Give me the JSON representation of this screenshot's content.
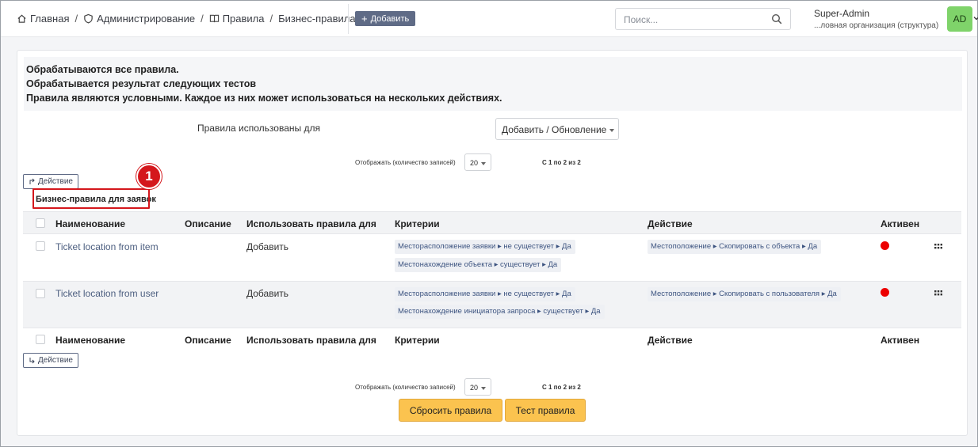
{
  "breadcrumb": [
    {
      "label": "Главная",
      "icon": "home-icon"
    },
    {
      "label": "Администрирование",
      "icon": "shield-icon"
    },
    {
      "label": "Правила",
      "icon": "book-icon"
    },
    {
      "label": "Бизнес-правила..."
    }
  ],
  "header": {
    "add_label": "Добавить",
    "search_placeholder": "Поиск...",
    "user_name": "Super-Admin",
    "user_org": "...ловная организация (структура)",
    "avatar": "AD"
  },
  "info": {
    "line1": "Обрабатываются все правила.",
    "line2": "Обрабатывается результат следующих тестов",
    "line3": "Правила являются условными. Каждое из них может использоваться на нескольких действиях."
  },
  "filter": {
    "label": "Правила использованы для",
    "selected": "Добавить / Обновление"
  },
  "pager": {
    "label": "Отображать (количество записей)",
    "value": "20",
    "count": "С 1 по 2 из 2"
  },
  "actions_label": "Действие",
  "section_title": "Бизнес-правила для заявок",
  "columns": {
    "name": "Наименование",
    "description": "Описание",
    "used_for": "Использовать правила для",
    "criteria": "Критерии",
    "action": "Действие",
    "active": "Активен"
  },
  "rows": [
    {
      "name": "Ticket location from item",
      "used_for": "Добавить",
      "criteria": [
        "Месторасположение заявки ▸ не существует ▸ Да",
        "Местонахождение объекта ▸ существует ▸ Да"
      ],
      "action": "Местоположение ▸ Скопировать с объекта ▸ Да",
      "active_color": "#ec0000"
    },
    {
      "name": "Ticket location from user",
      "used_for": "Добавить",
      "criteria": [
        "Месторасположение заявки ▸ не существует ▸ Да",
        "Местонахождение инициатора запроса ▸ существует ▸ Да"
      ],
      "action": "Местоположение ▸ Скопировать с пользователя ▸ Да",
      "active_color": "#ec0000"
    }
  ],
  "buttons": {
    "reset": "Сбросить правила",
    "test": "Тест правила"
  },
  "annotation": {
    "marker": "1"
  },
  "colors": {
    "accent": "#5f6b86",
    "button_yellow": "#fbc34f",
    "highlight": "#d4171c"
  }
}
